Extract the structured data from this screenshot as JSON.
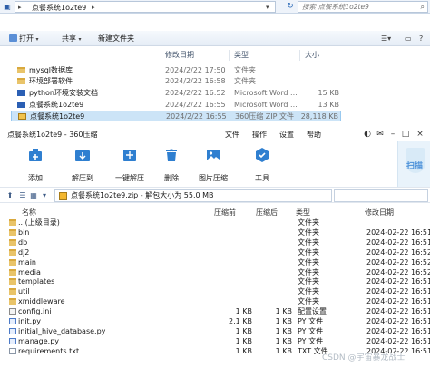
{
  "explorer": {
    "path_segments": [
      "点餐系统1o2te9"
    ],
    "search_placeholder": "搜索 点餐系统1o2te9",
    "toolbar": {
      "open": "打开",
      "share": "共享",
      "new_folder": "新建文件夹"
    },
    "columns": {
      "date": "修改日期",
      "type": "类型",
      "size": "大小"
    },
    "rows": [
      {
        "name": "mysql数据库",
        "date": "2024/2/22 17:50",
        "type": "文件夹",
        "size": "",
        "icon": "folder-icon"
      },
      {
        "name": "环境部署软件",
        "date": "2024/2/22 16:58",
        "type": "文件夹",
        "size": "",
        "icon": "folder-icon"
      },
      {
        "name": "python环境安装文档",
        "date": "2024/2/22 16:52",
        "type": "Microsoft Word ...",
        "size": "15 KB",
        "icon": "word-doc-icon"
      },
      {
        "name": "点餐系统1o2te9",
        "date": "2024/2/22 16:55",
        "type": "Microsoft Word ...",
        "size": "13 KB",
        "icon": "word-doc-icon"
      },
      {
        "name": "点餐系统1o2te9",
        "date": "2024/2/22 16:55",
        "type": "360压缩 ZIP 文件",
        "size": "28,118 KB",
        "icon": "zip-file-icon",
        "selected": true
      }
    ]
  },
  "zip": {
    "title": "点餐系统1o2te9 - 360压缩",
    "menu": [
      "文件",
      "操作",
      "设置",
      "帮助"
    ],
    "tools": [
      {
        "label": "添加",
        "icon": "add-icon",
        "color": "#2f7fd0"
      },
      {
        "label": "解压到",
        "icon": "extract-to-icon",
        "color": "#2f7fd0"
      },
      {
        "label": "一键解压",
        "icon": "one-click-extract-icon",
        "color": "#2f7fd0"
      },
      {
        "label": "删除",
        "icon": "delete-icon",
        "color": "#2f7fd0"
      },
      {
        "label": "图片压缩",
        "icon": "image-compress-icon",
        "color": "#2f7fd0"
      },
      {
        "label": "工具",
        "icon": "tools-icon",
        "color": "#2f7fd0"
      }
    ],
    "scan_label": "扫描",
    "address": "点餐系统1o2te9.zip - 解包大小为 55.0 MB",
    "columns": {
      "name": "名称",
      "compressed": "压缩前",
      "after": "压缩后",
      "type": "类型",
      "modified": "修改日期"
    },
    "rows": [
      {
        "name": ".. (上级目录)",
        "before": "",
        "after": "",
        "type": "文件夹",
        "date": "",
        "icon": "parent-dir-icon"
      },
      {
        "name": "bin",
        "before": "",
        "after": "",
        "type": "文件夹",
        "date": "2024-02-22 16:51",
        "icon": "folder-icon"
      },
      {
        "name": "db",
        "before": "",
        "after": "",
        "type": "文件夹",
        "date": "2024-02-22 16:51",
        "icon": "folder-icon"
      },
      {
        "name": "dj2",
        "before": "",
        "after": "",
        "type": "文件夹",
        "date": "2024-02-22 16:52",
        "icon": "folder-icon"
      },
      {
        "name": "main",
        "before": "",
        "after": "",
        "type": "文件夹",
        "date": "2024-02-22 16:52",
        "icon": "folder-icon"
      },
      {
        "name": "media",
        "before": "",
        "after": "",
        "type": "文件夹",
        "date": "2024-02-22 16:52",
        "icon": "folder-icon"
      },
      {
        "name": "templates",
        "before": "",
        "after": "",
        "type": "文件夹",
        "date": "2024-02-22 16:51",
        "icon": "folder-icon"
      },
      {
        "name": "util",
        "before": "",
        "after": "",
        "type": "文件夹",
        "date": "2024-02-22 16:51",
        "icon": "folder-icon"
      },
      {
        "name": "xmiddleware",
        "before": "",
        "after": "",
        "type": "文件夹",
        "date": "2024-02-22 16:51",
        "icon": "folder-icon"
      },
      {
        "name": "config.ini",
        "before": "1 KB",
        "after": "1 KB",
        "type": "配置设置",
        "date": "2024-02-22 16:51",
        "icon": "ini-file-icon"
      },
      {
        "name": "init.py",
        "before": "2.1 KB",
        "after": "1 KB",
        "type": "PY 文件",
        "date": "2024-02-22 16:51",
        "icon": "python-file-icon"
      },
      {
        "name": "initial_hive_database.py",
        "before": "1 KB",
        "after": "1 KB",
        "type": "PY 文件",
        "date": "2024-02-22 16:51",
        "icon": "python-file-icon"
      },
      {
        "name": "manage.py",
        "before": "1 KB",
        "after": "1 KB",
        "type": "PY 文件",
        "date": "2024-02-22 16:51",
        "icon": "python-file-icon"
      },
      {
        "name": "requirements.txt",
        "before": "1 KB",
        "after": "1 KB",
        "type": "TXT 文件",
        "date": "2024-02-22 16:51",
        "icon": "text-file-icon"
      }
    ]
  },
  "watermark": "CSDN @宇宙暴龙战士"
}
